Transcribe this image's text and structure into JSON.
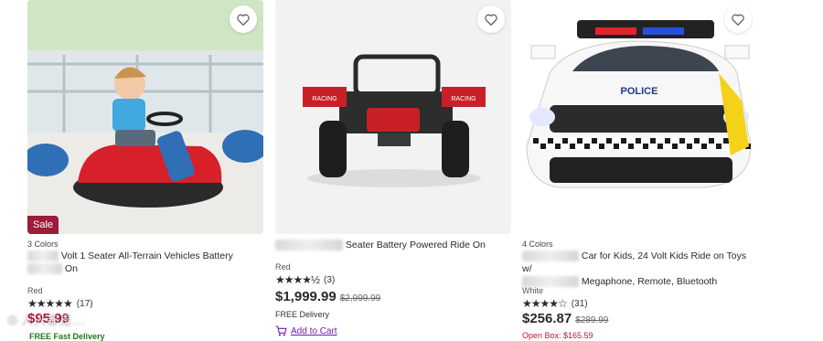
{
  "products": [
    {
      "badge": "Sale",
      "colors_label": "3 Colors",
      "title_line1": "Volt 1 Seater All-Terrain Vehicles Battery",
      "title_line2": "On",
      "variant": "Red",
      "rating": {
        "stars": 5,
        "count": "(17)"
      },
      "price": "$95.99",
      "shipping": "FREE Fast Delivery",
      "image_icon": "bumper-car-photo"
    },
    {
      "title_line1": "Seater Battery Powered Ride On",
      "variant": "Red",
      "rating": {
        "stars": 4.5,
        "count": "(3)"
      },
      "price": "$1,999.99",
      "was_price": "$2,999.99",
      "shipping": "FREE Delivery",
      "add_to_cart": "Add to Cart",
      "image_icon": "utv-ride-on-photo"
    },
    {
      "colors_label": "4 Colors",
      "title_line1": "Car for Kids, 24 Volt Kids Ride on Toys w/",
      "title_line2": "Megaphone, Remote, Bluetooth",
      "variant": "White",
      "rating": {
        "stars": 4,
        "count": "(31)"
      },
      "price": "$256.87",
      "was_price": "$289.99",
      "open_box": "Open Box: $165.59",
      "image_icon": "police-suv-photo"
    }
  ],
  "police_text": "POLICE",
  "racing_text": "RACING",
  "watermark": "人人都是...",
  "colors": {
    "sale": "#9c1c3a",
    "purple": "#6a1fb0",
    "price_red": "#b0143a"
  }
}
